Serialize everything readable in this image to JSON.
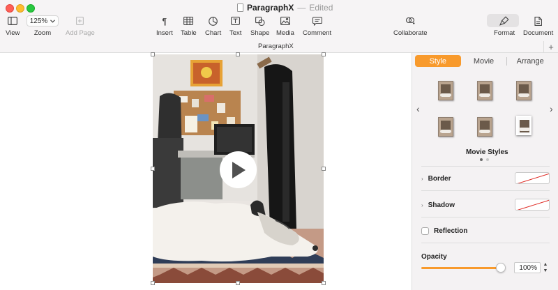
{
  "window": {
    "doc_name": "ParagraphX",
    "separator": "—",
    "state": "Edited"
  },
  "toolbar": {
    "view": "View",
    "zoom_value": "125%",
    "zoom": "Zoom",
    "add_page": "Add Page",
    "insert": "Insert",
    "table": "Table",
    "chart": "Chart",
    "text": "Text",
    "shape": "Shape",
    "media": "Media",
    "comment": "Comment",
    "collaborate": "Collaborate",
    "format": "Format",
    "document": "Document"
  },
  "subheader": {
    "doc_name": "ParagraphX",
    "plus": "+"
  },
  "canvas": {
    "play_icon": "play-icon"
  },
  "inspector": {
    "tabs": [
      {
        "label": "Style",
        "active": true
      },
      {
        "label": "Movie",
        "active": false
      },
      {
        "label": "Arrange",
        "active": false
      }
    ],
    "nav_prev": "‹",
    "nav_next": "›",
    "movie_styles_label": "Movie Styles",
    "border_label": "Border",
    "shadow_label": "Shadow",
    "reflection_label": "Reflection",
    "opacity_label": "Opacity",
    "opacity_value": "100%",
    "opacity_level": 1.0,
    "accent_color": "#f89a2c"
  }
}
